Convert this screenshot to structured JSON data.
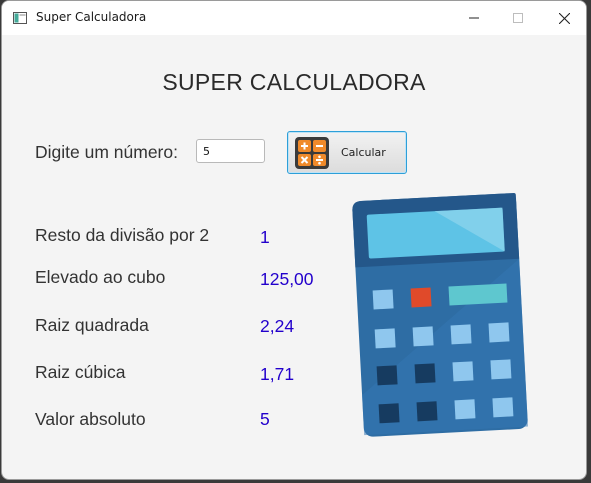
{
  "window": {
    "title": "Super Calculadora",
    "controls": [
      "minimize",
      "maximize",
      "close"
    ]
  },
  "main": {
    "heading": "SUPER CALCULADORA",
    "input": {
      "label": "Digite um número:",
      "value": "5",
      "placeholder": ""
    },
    "button": {
      "label": "Calcular",
      "icon": "calculator-operators-icon"
    },
    "results": [
      {
        "label": "Resto da divisão por 2",
        "value": "1"
      },
      {
        "label": "Elevado ao cubo",
        "value": "125,00"
      },
      {
        "label": "Raiz quadrada",
        "value": "2,24"
      },
      {
        "label": "Raiz cúbica",
        "value": "1,71"
      },
      {
        "label": "Valor absoluto",
        "value": "5"
      }
    ],
    "illustration": "calculator-icon"
  },
  "colors": {
    "result_value": "#2200cc",
    "button_border": "#2d9fd8",
    "calc_body": "#2e6da4",
    "calc_top": "#24578a",
    "calc_screen": "#5ec3e6",
    "calc_red_key": "#e04a2a",
    "calc_cyan_key": "#5ec7cf"
  }
}
